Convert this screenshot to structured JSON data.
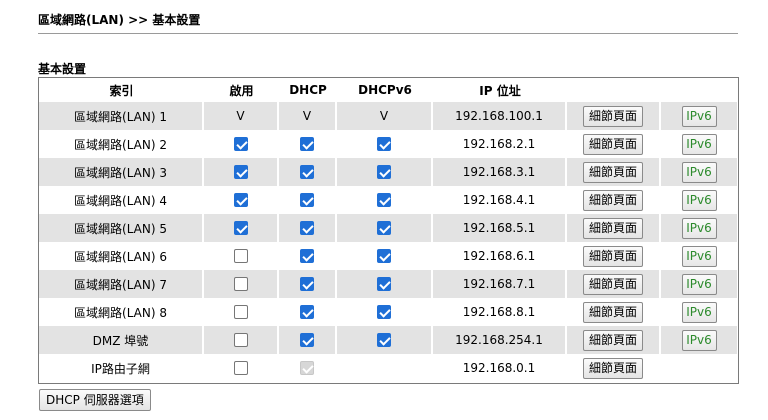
{
  "breadcrumb": "區域網路(LAN) >> 基本設置",
  "section_title": "基本設置",
  "columns": {
    "index": "索引",
    "enable": "啟用",
    "dhcp": "DHCP",
    "dhcpv6": "DHCPv6",
    "ip": "IP 位址"
  },
  "rows": [
    {
      "name": "區域網路(LAN) 1",
      "enable": "V",
      "dhcp": "V",
      "dhcpv6": "V",
      "ip": "192.168.100.1",
      "detail": "細節頁面",
      "ipv6": "IPv6"
    },
    {
      "name": "區域網路(LAN) 2",
      "enable": "checked",
      "dhcp": "checked",
      "dhcpv6": "checked",
      "ip": "192.168.2.1",
      "detail": "細節頁面",
      "ipv6": "IPv6"
    },
    {
      "name": "區域網路(LAN) 3",
      "enable": "checked",
      "dhcp": "checked",
      "dhcpv6": "checked",
      "ip": "192.168.3.1",
      "detail": "細節頁面",
      "ipv6": "IPv6"
    },
    {
      "name": "區域網路(LAN) 4",
      "enable": "checked",
      "dhcp": "checked",
      "dhcpv6": "checked",
      "ip": "192.168.4.1",
      "detail": "細節頁面",
      "ipv6": "IPv6"
    },
    {
      "name": "區域網路(LAN) 5",
      "enable": "checked",
      "dhcp": "checked",
      "dhcpv6": "checked",
      "ip": "192.168.5.1",
      "detail": "細節頁面",
      "ipv6": "IPv6"
    },
    {
      "name": "區域網路(LAN) 6",
      "enable": "unchecked",
      "dhcp": "checked",
      "dhcpv6": "checked",
      "ip": "192.168.6.1",
      "detail": "細節頁面",
      "ipv6": "IPv6"
    },
    {
      "name": "區域網路(LAN) 7",
      "enable": "unchecked",
      "dhcp": "checked",
      "dhcpv6": "checked",
      "ip": "192.168.7.1",
      "detail": "細節頁面",
      "ipv6": "IPv6"
    },
    {
      "name": "區域網路(LAN) 8",
      "enable": "unchecked",
      "dhcp": "checked",
      "dhcpv6": "checked",
      "ip": "192.168.8.1",
      "detail": "細節頁面",
      "ipv6": "IPv6"
    },
    {
      "name": "DMZ 埠號",
      "enable": "unchecked",
      "dhcp": "checked",
      "dhcpv6": "checked",
      "ip": "192.168.254.1",
      "detail": "細節頁面",
      "ipv6": "IPv6"
    },
    {
      "name": "IP路由子網",
      "enable": "unchecked",
      "dhcp": "disabled-checked",
      "dhcpv6": "none",
      "ip": "192.168.0.1",
      "detail": "細節頁面",
      "ipv6": ""
    }
  ],
  "footer_button": "DHCP 伺服器選項",
  "colors": {
    "checkbox_checked": "#1f6fd6",
    "row_alt": "#e3e3e3",
    "ipv6_text": "#2c8a2c"
  }
}
